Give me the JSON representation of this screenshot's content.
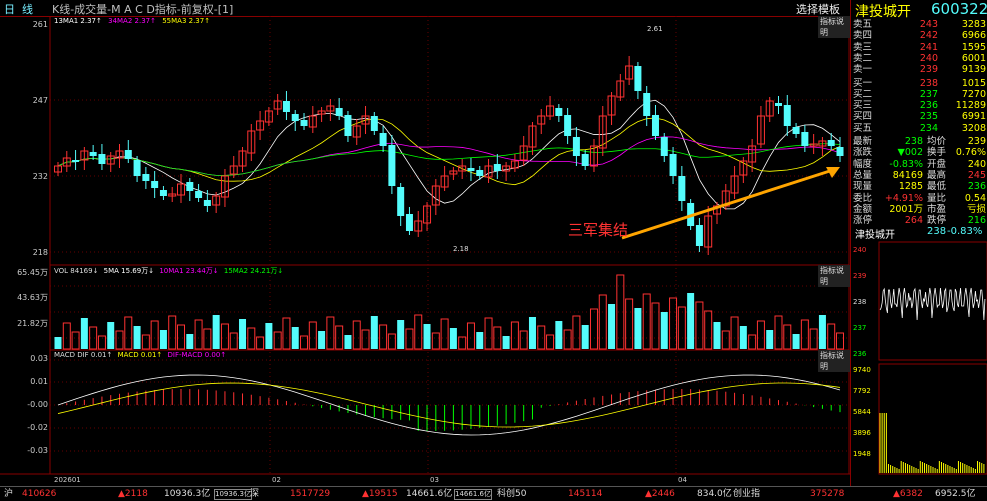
{
  "topbar": {
    "period": "日",
    "period2": "线",
    "chart_title": "K线-成交量-M A C D指标-前复权-[1]",
    "select_template": "选择模板",
    "explain": "指标说明"
  },
  "ma_legend": {
    "ma13": "13MA1 2.37↑",
    "ma34": "34MA2 2.37↑",
    "ma55": "55MA3 2.37↑"
  },
  "vol_legend": {
    "vol": "VOL 84169↓",
    "ma5": "5MA 15.69万↓",
    "ma10": "10MA1 23.44万↓",
    "ma15": "15MA2 24.21万↓"
  },
  "macd_legend": {
    "name": "MACD DIF 0.01↑",
    "dea": "MACD 0.01↑",
    "dif": "DIF-MACD 0.00↑"
  },
  "price_axis": [
    "261",
    "247",
    "232",
    "218"
  ],
  "vol_axis": [
    "65.45万",
    "43.63万",
    "21.82万"
  ],
  "macd_axis": [
    "0.03",
    "0.01",
    "-0.00",
    "-0.02",
    "-0.03"
  ],
  "time_axis": [
    "202601",
    "02",
    "03",
    "04"
  ],
  "annotations": {
    "high": "2.61",
    "low": "2.18",
    "callout": "三军集结"
  },
  "colors": {
    "up": "#ff3232",
    "down": "#54fcfc",
    "ma13": "#ffffff",
    "ma34": "#ffff00",
    "ma55": "#ff00ff",
    "arrow": "#ffa500"
  },
  "quote": {
    "name": "津投城开",
    "code": "600322",
    "sell": [
      {
        "label": "卖五",
        "price": "243",
        "vol": "3283"
      },
      {
        "label": "卖四",
        "price": "242",
        "vol": "6966"
      },
      {
        "label": "卖三",
        "price": "241",
        "vol": "1595"
      },
      {
        "label": "卖二",
        "price": "240",
        "vol": "6001"
      },
      {
        "label": "卖一",
        "price": "239",
        "vol": "9139"
      }
    ],
    "buy": [
      {
        "label": "买一",
        "price": "238",
        "vol": "1015"
      },
      {
        "label": "买二",
        "price": "237",
        "vol": "7270"
      },
      {
        "label": "买三",
        "price": "236",
        "vol": "11289"
      },
      {
        "label": "买四",
        "price": "235",
        "vol": "6991"
      },
      {
        "label": "买五",
        "price": "234",
        "vol": "3208"
      }
    ],
    "stats": [
      {
        "l1": "最新",
        "v1": "238",
        "l2": "均价",
        "v2": "239"
      },
      {
        "l1": "涨跌",
        "v1": "▼002",
        "l2": "换手",
        "v2": "0.76%"
      },
      {
        "l1": "幅度",
        "v1": "-0.83%",
        "l2": "开盘",
        "v2": "240"
      },
      {
        "l1": "总量",
        "v1": "84169",
        "l2": "最高",
        "v2": "245"
      },
      {
        "l1": "现量",
        "v1": "1285",
        "l2": "最低",
        "v2": "236"
      },
      {
        "l1": "委比",
        "v1": "+4.91%",
        "l2": "量比",
        "v2": "0.54"
      },
      {
        "l1": "金额",
        "v1": "2001万",
        "l2": "市盈",
        "v2": "亏损"
      },
      {
        "l1": "涨停",
        "v1": "264",
        "l2": "跌停",
        "v2": "216"
      }
    ],
    "mini_title": "津投城开",
    "mini_price": "238",
    "mini_change": "-0.83%",
    "mini_axis1": [
      "240",
      "239",
      "238",
      "237",
      "236"
    ],
    "mini_axis2": [
      "9740",
      "7792",
      "5844",
      "3896",
      "1948"
    ]
  },
  "bottombar": {
    "sh_label": "沪",
    "sh_val": "410626",
    "sh_chg": "▲2118",
    "sh_amt": "10936.3亿",
    "sh_box": "10936.3亿",
    "sz_label": "深",
    "sz_val": "1517729",
    "sz_chg": "▲19515",
    "sz_amt": "14661.6亿",
    "sz_box": "14661.6亿",
    "kc_label": "科创50",
    "kc_val": "145114",
    "kc_chg": "▲2446",
    "kc_amt": "834.0亿",
    "cy_label": "创业指",
    "cy_val": "375278",
    "cy_chg": "▲6382",
    "cy_amt": "6952.5亿"
  }
}
